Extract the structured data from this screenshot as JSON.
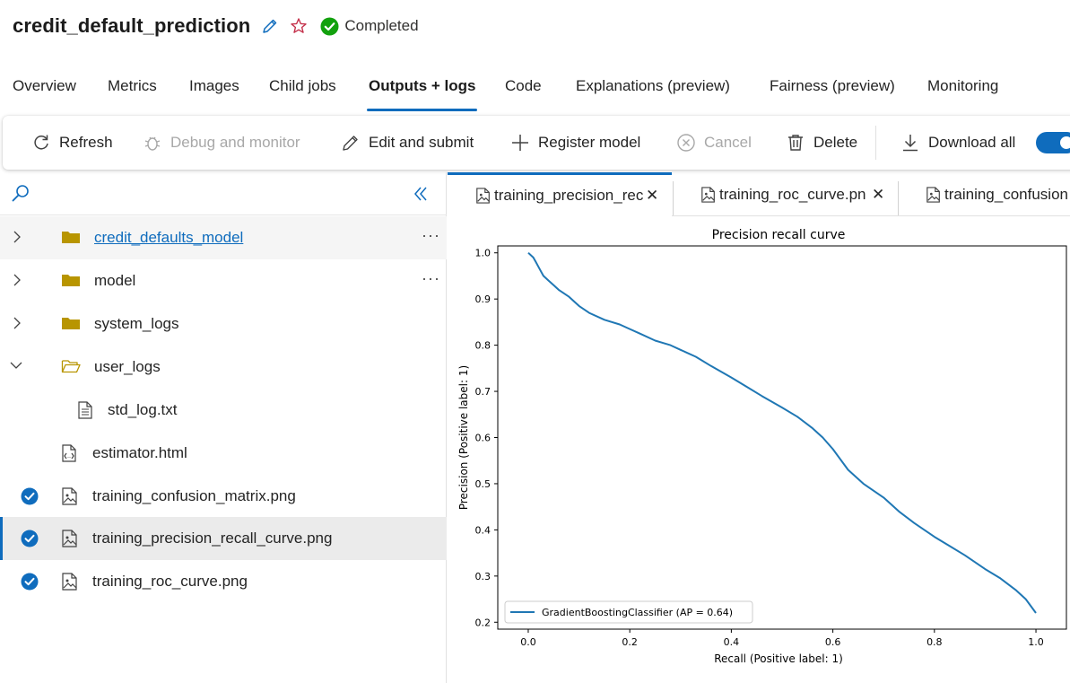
{
  "header": {
    "title": "credit_default_prediction",
    "status": "Completed",
    "colors": {
      "status_green": "#13a10e",
      "accent": "#0f6cbd"
    }
  },
  "tabs": [
    {
      "label": "Overview"
    },
    {
      "label": "Metrics"
    },
    {
      "label": "Images"
    },
    {
      "label": "Child jobs"
    },
    {
      "label": "Outputs + logs",
      "active": true
    },
    {
      "label": "Code"
    },
    {
      "label": "Explanations (preview)"
    },
    {
      "label": "Fairness (preview)"
    },
    {
      "label": "Monitoring"
    }
  ],
  "toolbar": {
    "refresh": "Refresh",
    "debug": "Debug and monitor",
    "edit": "Edit and submit",
    "register": "Register model",
    "cancel": "Cancel",
    "delete": "Delete",
    "download": "Download all"
  },
  "tree": {
    "items": [
      {
        "label": "credit_defaults_model",
        "type": "folder",
        "expanded": false
      },
      {
        "label": "model",
        "type": "folder",
        "expanded": false
      },
      {
        "label": "system_logs",
        "type": "folder",
        "expanded": false
      },
      {
        "label": "user_logs",
        "type": "folder",
        "expanded": true
      },
      {
        "label": "std_log.txt",
        "type": "file"
      },
      {
        "label": "estimator.html",
        "type": "file"
      },
      {
        "label": "training_confusion_matrix.png",
        "type": "image",
        "checked": true
      },
      {
        "label": "training_precision_recall_curve.png",
        "type": "image",
        "checked": true,
        "selected": true
      },
      {
        "label": "training_roc_curve.png",
        "type": "image",
        "checked": true
      }
    ]
  },
  "doc_tabs": [
    {
      "label": "training_precision_rec",
      "active": true
    },
    {
      "label": "training_roc_curve.pn"
    },
    {
      "label": "training_confusion"
    }
  ],
  "chart_data": {
    "type": "line",
    "title": "Precision recall curve",
    "xlabel": "Recall (Positive label: 1)",
    "ylabel": "Precision (Positive label: 1)",
    "xlim": [
      -0.06,
      1.06
    ],
    "ylim": [
      0.185,
      1.015
    ],
    "xticks": [
      "0.0",
      "0.2",
      "0.4",
      "0.6",
      "0.8",
      "1.0"
    ],
    "yticks": [
      "0.2",
      "0.3",
      "0.4",
      "0.5",
      "0.6",
      "0.7",
      "0.8",
      "0.9",
      "1.0"
    ],
    "legend_position": "lower-left",
    "series": [
      {
        "name": "GradientBoostingClassifier (AP = 0.64)",
        "color": "#1f77b4",
        "x": [
          0.0,
          0.01,
          0.015,
          0.02,
          0.025,
          0.03,
          0.04,
          0.05,
          0.06,
          0.08,
          0.1,
          0.12,
          0.15,
          0.18,
          0.2,
          0.22,
          0.25,
          0.28,
          0.3,
          0.33,
          0.36,
          0.4,
          0.43,
          0.46,
          0.5,
          0.53,
          0.56,
          0.58,
          0.6,
          0.63,
          0.66,
          0.7,
          0.73,
          0.76,
          0.8,
          0.83,
          0.86,
          0.9,
          0.93,
          0.96,
          0.98,
          1.0
        ],
        "y": [
          1.0,
          0.99,
          0.98,
          0.97,
          0.96,
          0.95,
          0.94,
          0.93,
          0.92,
          0.905,
          0.885,
          0.87,
          0.855,
          0.845,
          0.835,
          0.825,
          0.81,
          0.8,
          0.79,
          0.775,
          0.755,
          0.73,
          0.71,
          0.69,
          0.665,
          0.645,
          0.62,
          0.6,
          0.575,
          0.53,
          0.5,
          0.47,
          0.44,
          0.415,
          0.385,
          0.365,
          0.345,
          0.315,
          0.295,
          0.27,
          0.25,
          0.22
        ]
      }
    ]
  }
}
